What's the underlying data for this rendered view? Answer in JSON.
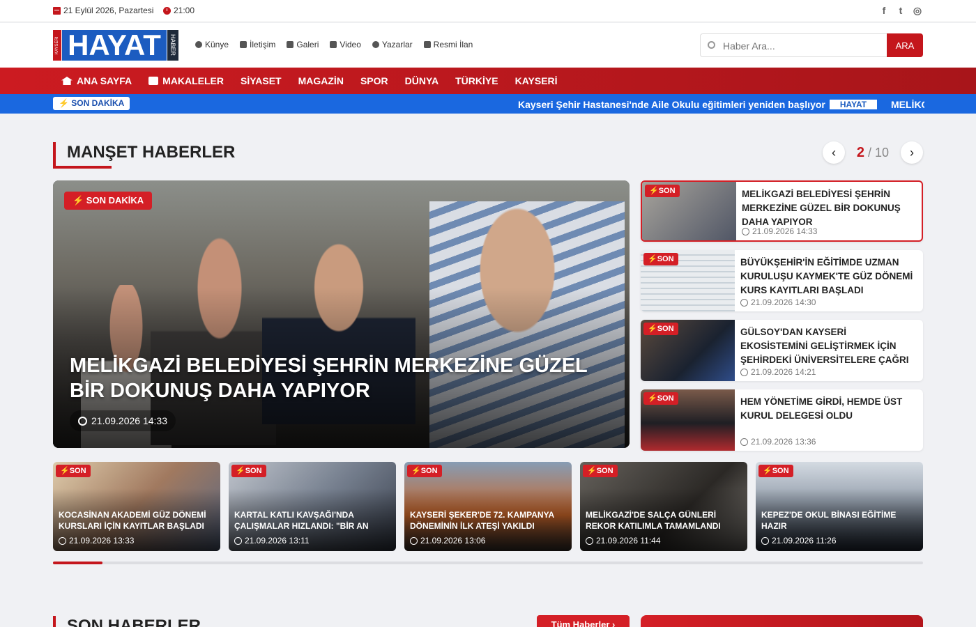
{
  "topbar": {
    "date": "21 Eylül 2026, Pazartesi",
    "time": "21:00",
    "social": [
      {
        "icon": "facebook-icon",
        "glyph": "f"
      },
      {
        "icon": "twitter-icon",
        "glyph": "t"
      },
      {
        "icon": "instagram-icon",
        "glyph": "◎"
      }
    ]
  },
  "logo": {
    "text": "HAYAT",
    "side_left": "KAYSERİ",
    "side_right": "HABER"
  },
  "topnav": [
    {
      "label": "Künye",
      "icon": "info-icon"
    },
    {
      "label": "İletişim",
      "icon": "envelope-icon"
    },
    {
      "label": "Galeri",
      "icon": "image-icon"
    },
    {
      "label": "Video",
      "icon": "video-icon"
    },
    {
      "label": "Yazarlar",
      "icon": "user-pen-icon"
    },
    {
      "label": "Resmi İlan",
      "icon": "file-icon"
    }
  ],
  "search": {
    "placeholder": "Haber Ara...",
    "button": "ARA"
  },
  "mainmenu": [
    "ANA SAYFA",
    "MAKALELER",
    "SİYASET",
    "MAGAZİN",
    "SPOR",
    "DÜNYA",
    "TÜRKİYE",
    "KAYSERİ"
  ],
  "ticker": {
    "badge_icon": "⚡",
    "badge": "SON DAKİKA",
    "text": "Kayseri Şehir Hastanesi'nde Aile Okulu eğitimleri yeniden başlıyor",
    "mini_logo": "HAYAT",
    "text2": "MELİKGAZİ"
  },
  "manset": {
    "title": "MANŞET HABERLER",
    "page_current": "2",
    "page_sep": "/ 10",
    "hero": {
      "tag": "⚡ SON DAKİKA",
      "title": "MELİKGAZİ BELEDİYESİ ŞEHRİN MERKEZİNE GÜZEL BİR DOKUNUŞ DAHA YAPIYOR",
      "date": "21.09.2026 14:33"
    },
    "side": [
      {
        "tag": "⚡SON",
        "title": "MELİKGAZİ BELEDİYESİ ŞEHRİN MERKEZİNE GÜZEL BİR DOKUNUŞ DAHA YAPIYOR",
        "date": "21.09.2026 14:33"
      },
      {
        "tag": "⚡SON",
        "title": "BÜYÜKŞEHİR'İN EĞİTİMDE UZMAN KURULUŞU KAYMEK'TE GÜZ DÖNEMİ KURS KAYITLARI BAŞLADI",
        "date": "21.09.2026 14:30"
      },
      {
        "tag": "⚡SON",
        "title": "GÜLSOY'DAN KAYSERİ EKOSİSTEMİNİ GELİŞTİRMEK İÇİN ŞEHİRDEKİ ÜNİVERSİTELERE ÇAĞRI",
        "date": "21.09.2026 14:21"
      },
      {
        "tag": "⚡SON",
        "title": "HEM YÖNETİME GİRDİ, HEMDE ÜST KURUL DELEGESİ OLDU",
        "date": "21.09.2026 13:36"
      }
    ],
    "strip": [
      {
        "tag": "⚡SON",
        "title": "KOCASİNAN AKADEMİ GÜZ DÖNEMİ KURSLARI İÇİN KAYITLAR BAŞLADI",
        "date": "21.09.2026 13:33"
      },
      {
        "tag": "⚡SON",
        "title": "KARTAL KATLI KAVŞAĞI'NDA ÇALIŞMALAR HIZLANDI: \"BİR AN EVVE...",
        "date": "21.09.2026 13:11"
      },
      {
        "tag": "⚡SON",
        "title": "KAYSERİ ŞEKER'DE 72. KAMPANYA DÖNEMİNİN İLK ATEŞİ YAKILDI",
        "date": "21.09.2026 13:06"
      },
      {
        "tag": "⚡SON",
        "title": "MELİKGAZİ'DE SALÇA GÜNLERİ REKOR KATILIMLA TAMAMLANDI",
        "date": "21.09.2026 11:44"
      },
      {
        "tag": "⚡SON",
        "title": "KEPEZ'DE OKUL BİNASI EĞİTİME HAZIR",
        "date": "21.09.2026 11:26"
      }
    ],
    "progress": 0.057
  },
  "son_haberler": {
    "title": "SON HABERLER",
    "all_button": "Tüm Haberler ›"
  },
  "colors": {
    "accent": "#c4161c",
    "ticker": "#1a68e0",
    "logo_blue": "#1c5cc0"
  }
}
